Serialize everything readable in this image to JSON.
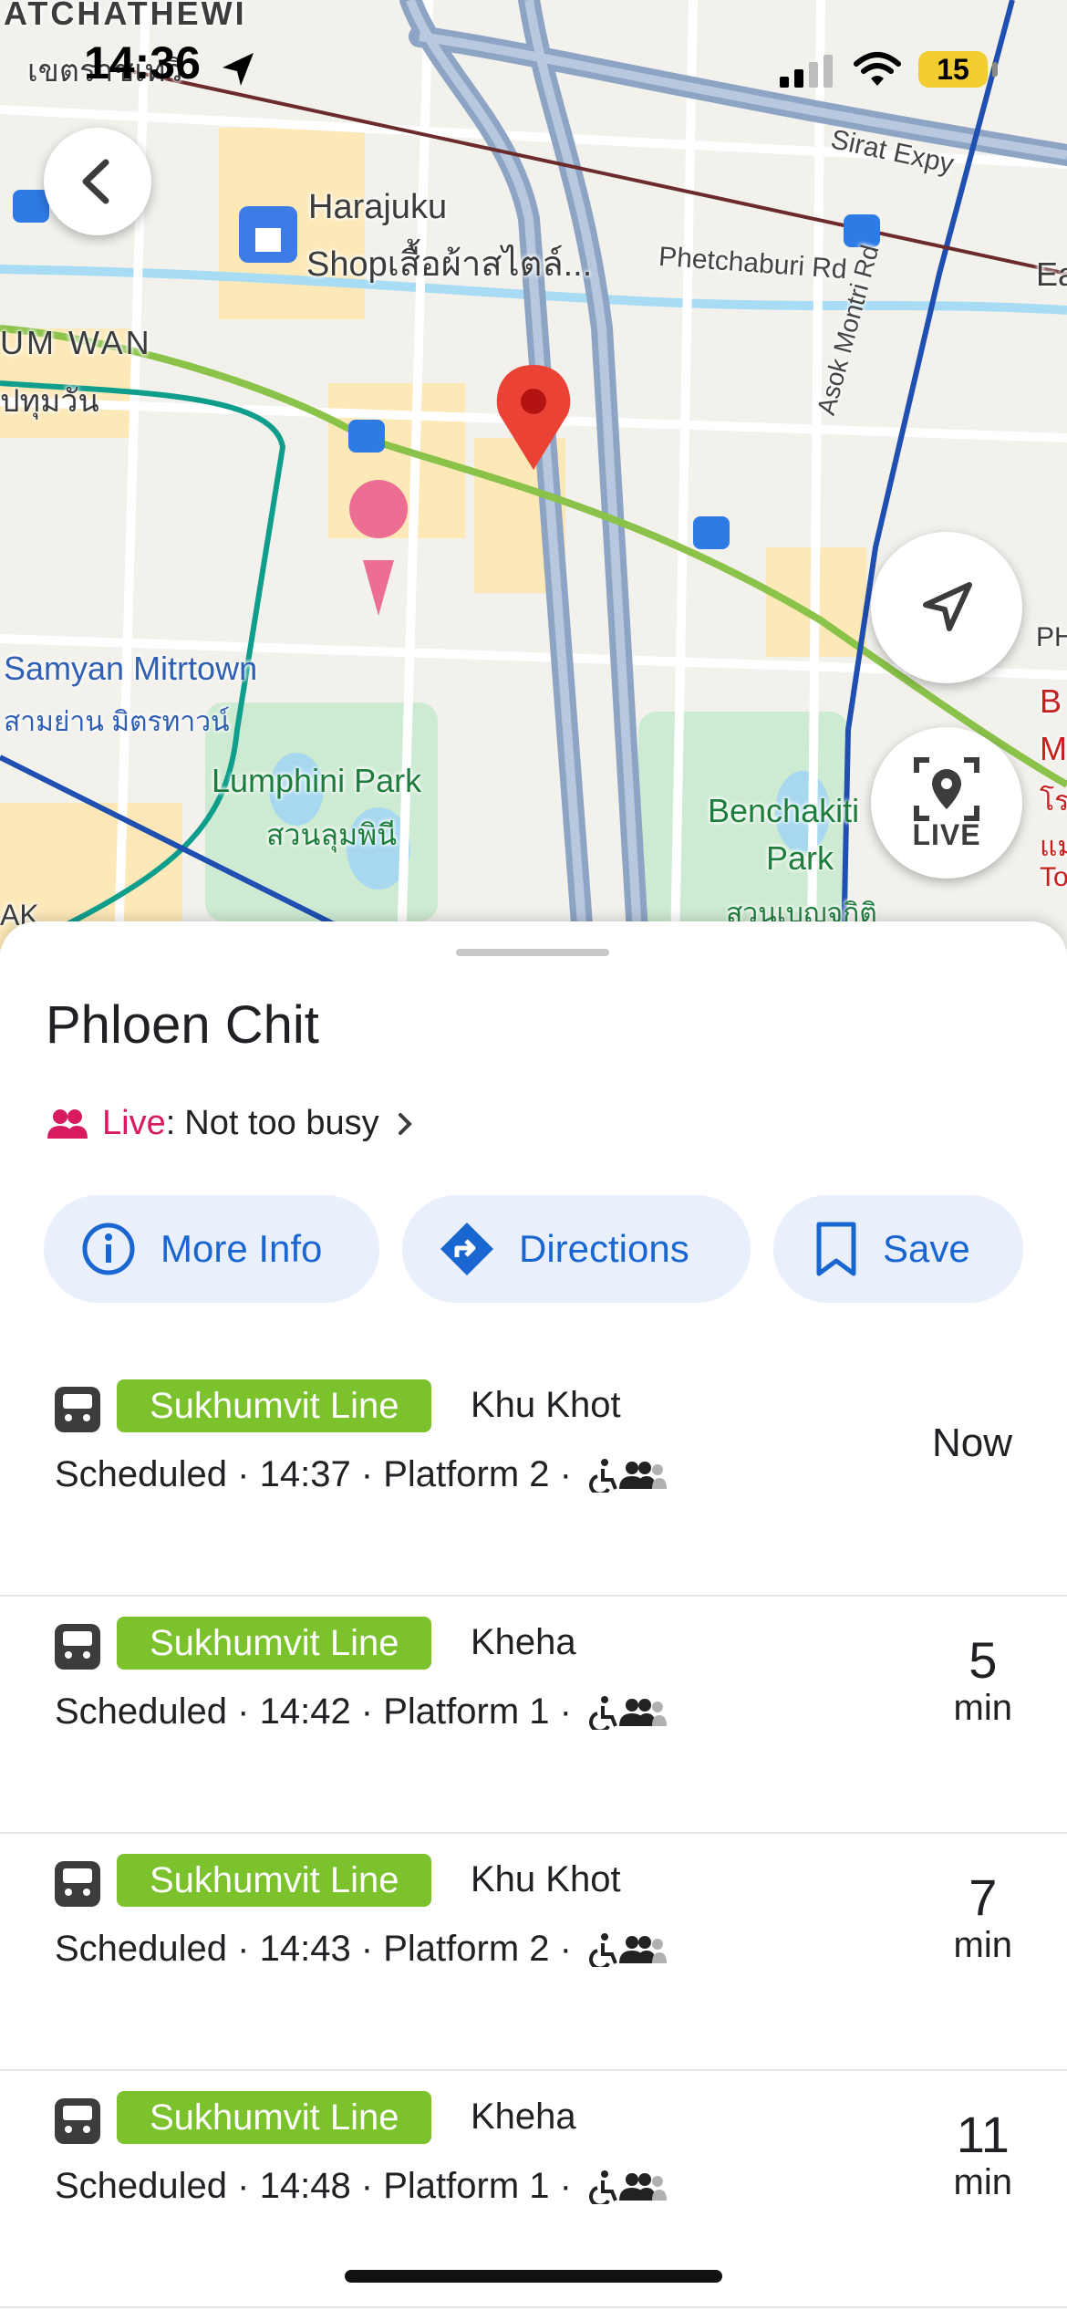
{
  "status_bar": {
    "time": "14:36",
    "battery": "15"
  },
  "map": {
    "labels": {
      "ratchathewi": "ATCHATHEWI",
      "ratchathewi_th": "เขตราชเทวี",
      "harajuku": "Harajuku",
      "harajuku_sub": "Shopเสื้อผ้าสไตล์...",
      "sirat": "Sirat Expy",
      "phetchaburi": "Phetchaburi Rd",
      "pathum_wan": "UM WAN",
      "pathum_wan_th": "ปทุมวัน",
      "asok": "Asok Montri Rd",
      "samyan": "Samyan Mitrtown",
      "samyan_th": "สามย่าน มิตรทาวน์",
      "lumphini": "Lumphini Park",
      "lumphini_th": "สวนลุมพินี",
      "benchakitti": "Benchakiti",
      "benchakitti_2": "Park",
      "benchakitti_th": "สวนเบญจกิติ",
      "ph": "PH",
      "ak": "AK",
      "ea": "Ea",
      "right_b": "B",
      "right_m": "M",
      "right_th1": "โร",
      "right_th2": "แม",
      "right_to": "To"
    },
    "live_button_label": "LIVE"
  },
  "place": {
    "name": "Phloen Chit",
    "live_word": "Live",
    "busy_status": "Not too busy"
  },
  "actions": {
    "more_info": "More Info",
    "directions": "Directions",
    "save": "Save"
  },
  "colors": {
    "accent_blue": "#1a66d1",
    "line_green": "#7cc22d",
    "live_pink": "#d81b60",
    "pin_red": "#ea4335"
  },
  "departures": [
    {
      "line": "Sukhumvit Line",
      "destination": "Khu Khot",
      "schedule": "Scheduled · 14:37 · Platform 2 ·",
      "eta_num": "Now",
      "eta_unit": ""
    },
    {
      "line": "Sukhumvit Line",
      "destination": "Kheha",
      "schedule": "Scheduled · 14:42 · Platform 1 ·",
      "eta_num": "5",
      "eta_unit": "min"
    },
    {
      "line": "Sukhumvit Line",
      "destination": "Khu Khot",
      "schedule": "Scheduled · 14:43 · Platform 2 ·",
      "eta_num": "7",
      "eta_unit": "min"
    },
    {
      "line": "Sukhumvit Line",
      "destination": "Kheha",
      "schedule": "Scheduled · 14:48 · Platform 1 ·",
      "eta_num": "11",
      "eta_unit": "min"
    }
  ]
}
